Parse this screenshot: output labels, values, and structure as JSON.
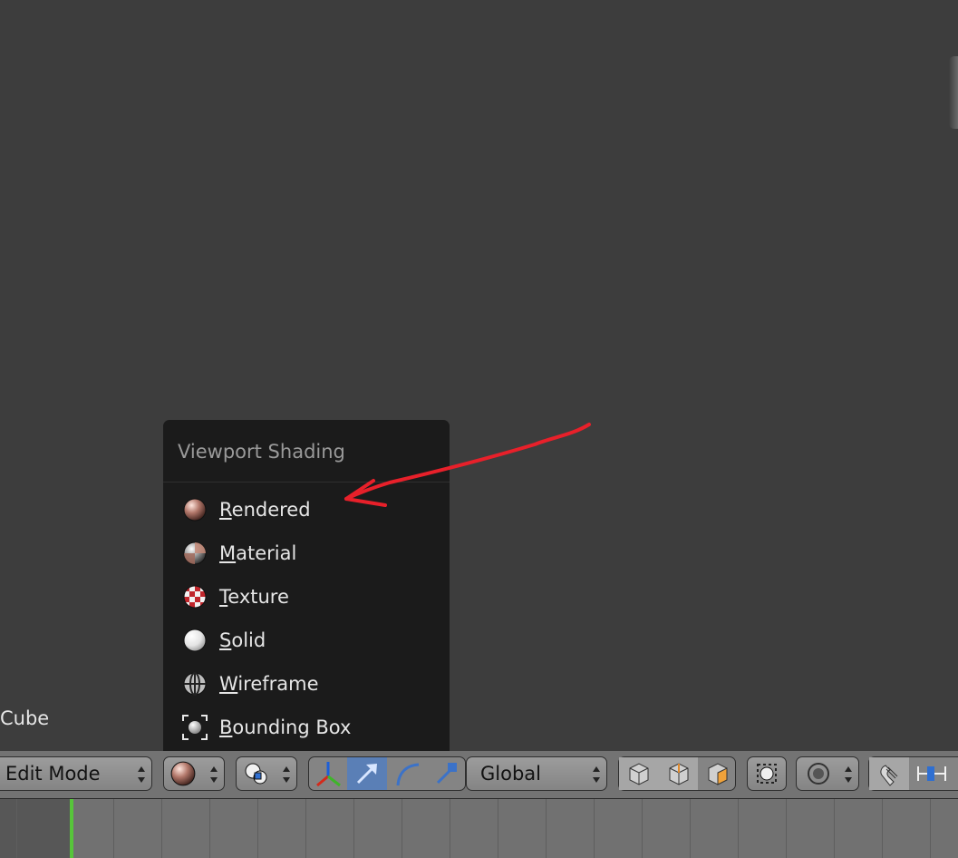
{
  "viewport": {
    "object_name": "Cube"
  },
  "popup": {
    "title": "Viewport Shading",
    "items": [
      {
        "label": "Rendered",
        "icon": "rendered-sphere-icon"
      },
      {
        "label": "Material",
        "icon": "material-sphere-icon"
      },
      {
        "label": "Texture",
        "icon": "texture-checker-icon"
      },
      {
        "label": "Solid",
        "icon": "solid-sphere-icon"
      },
      {
        "label": "Wireframe",
        "icon": "wireframe-sphere-icon"
      },
      {
        "label": "Bounding Box",
        "icon": "bounding-box-icon"
      }
    ]
  },
  "header": {
    "mode_selector": "Edit Mode",
    "transform_orientation": "Global"
  },
  "colors": {
    "viewport_bg": "#3d3d3d",
    "menu_bg": "#1b1b1b",
    "active_accent": "#5a7fb6",
    "annotation_arrow": "#e8202a",
    "current_frame": "#57c43a"
  }
}
